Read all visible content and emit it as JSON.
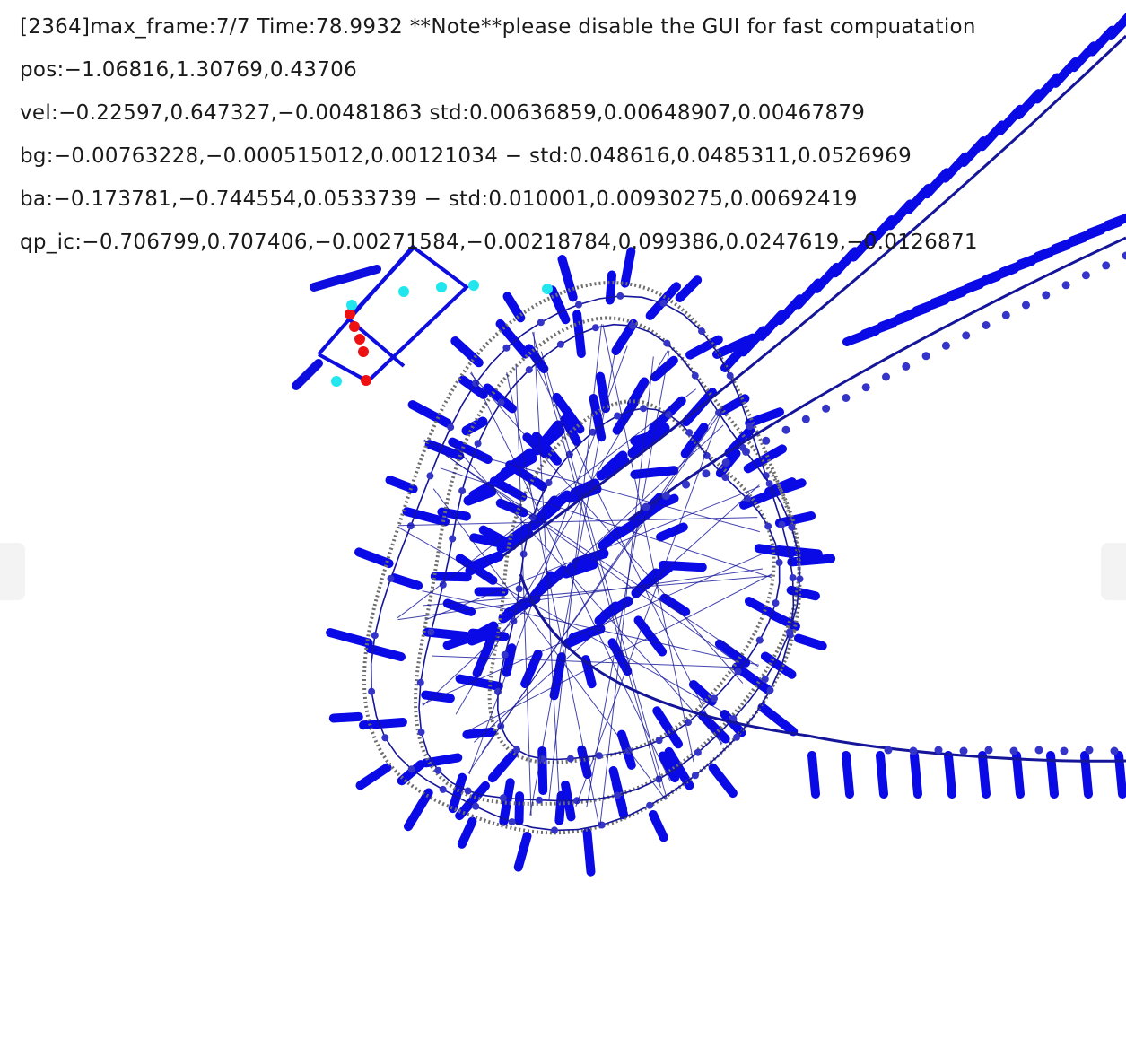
{
  "hud": {
    "status": "[2364]max_frame:7/7 Time:78.9932 **Note**please disable the GUI for fast compuatation",
    "pos": "pos:−1.06816,1.30769,0.43706",
    "vel": "vel:−0.22597,0.647327,−0.00481863 std:0.00636859,0.00648907,0.00467879",
    "bg": "bg:−0.00763228,−0.000515012,0.00121034 − std:0.048616,0.0485311,0.0526969",
    "ba": "ba:−0.173781,−0.744554,0.0533739 − std:0.010001,0.00930275,0.00692419",
    "qp_ic": "qp_ic:−0.706799,0.707406,−0.00271584,−0.00218784,0.099386,0.0247619,−0.0126871"
  },
  "colors": {
    "background": "#ffffff",
    "imu_ticks": "#0a0ae6",
    "trajectory": "#15159a",
    "trajectory_nodes": "#3434c8",
    "groundtruth": "#6e6e6e",
    "camera_frustum": "#0d0de0",
    "current_frames": "#ee1111",
    "keyframe_markers": "#22e6ee",
    "text": "#1a1a1a"
  },
  "icons": {
    "left_handle": "chevron-left-handle",
    "right_handle": "chevron-right-handle"
  }
}
